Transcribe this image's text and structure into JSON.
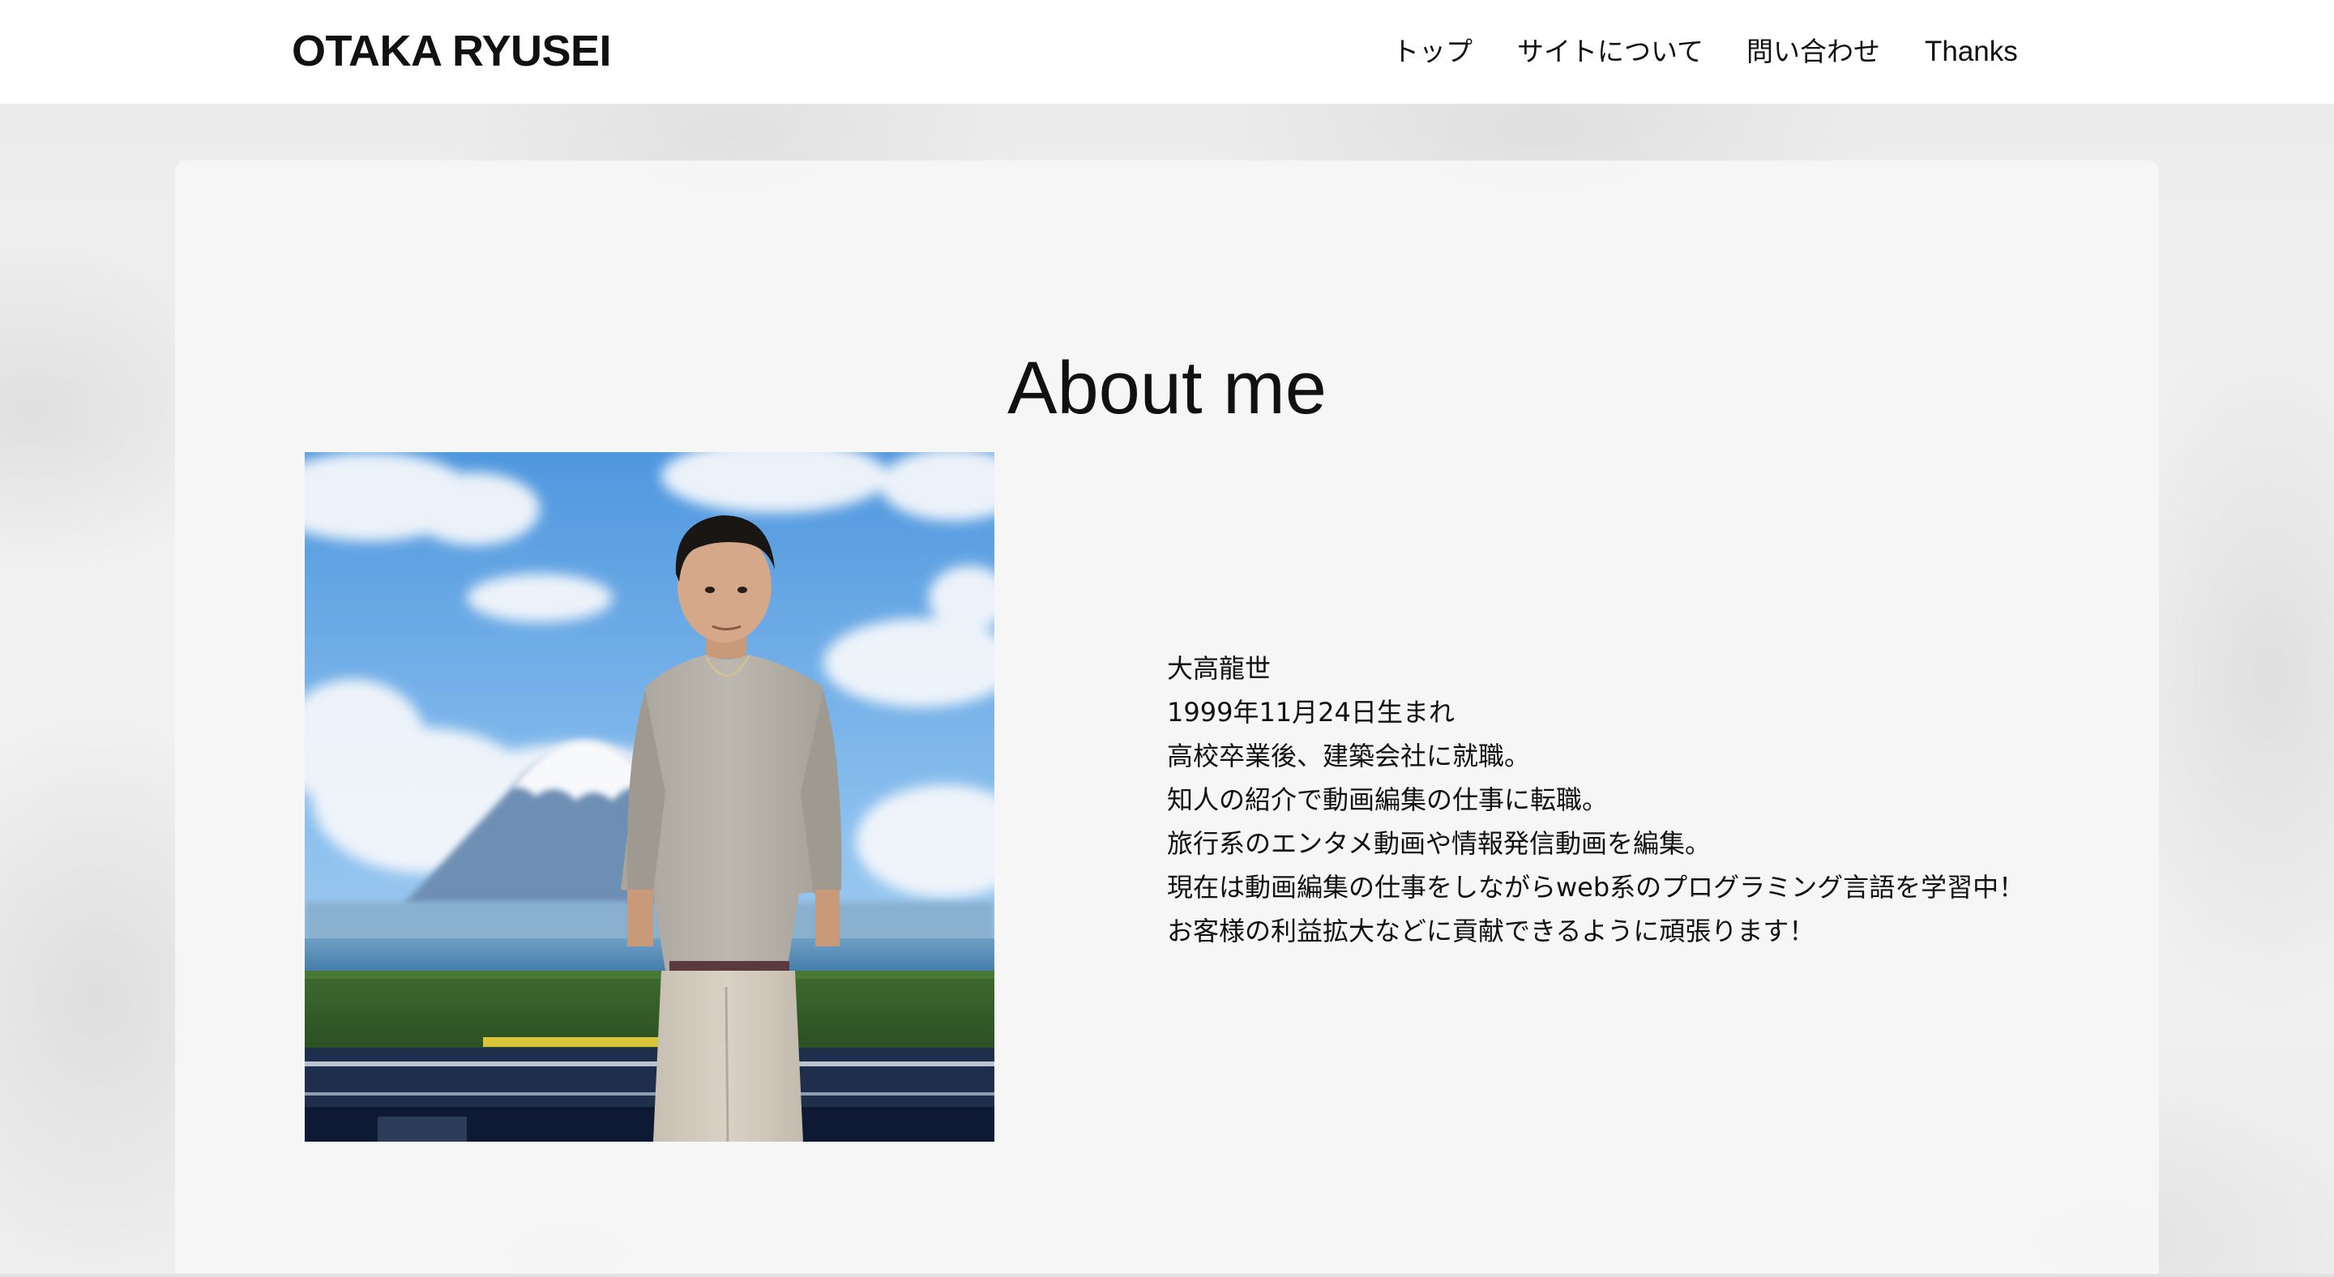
{
  "header": {
    "logo": "OTAKA RYUSEI",
    "nav": [
      {
        "label": "トップ"
      },
      {
        "label": "サイトについて"
      },
      {
        "label": "問い合わせ"
      },
      {
        "label": "Thanks"
      }
    ]
  },
  "main": {
    "title": "About me",
    "bio": [
      "大高龍世",
      "1999年11月24日生まれ",
      "高校卒業後、建築会社に就職。",
      "知人の紹介で動画編集の仕事に転職。",
      "旅行系のエンタメ動画や情報発信動画を編集。",
      "現在は動画編集の仕事をしながらweb系のプログラミング言語を学習中！",
      "お客様の利益拡大などに貢献できるように頑張ります！"
    ]
  },
  "colors": {
    "header_bg": "#ffffff",
    "text": "#111111",
    "panel_bg": "#f6f6f6",
    "sky": "#5fa3e2"
  },
  "icons": {
    "profile_photo": "profile-photo"
  }
}
